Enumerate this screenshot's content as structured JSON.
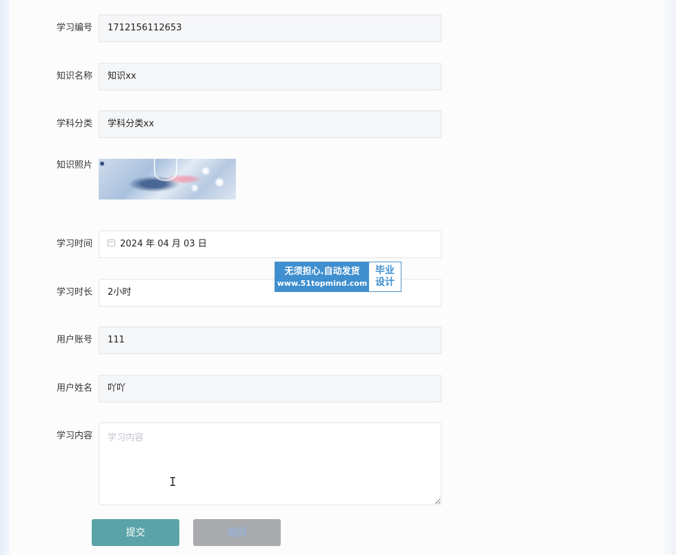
{
  "form": {
    "fields": [
      {
        "label": "学习编号",
        "value": "1712156112653"
      },
      {
        "label": "知识名称",
        "value": "知识xx"
      },
      {
        "label": "学科分类",
        "value": "学科分类xx"
      },
      {
        "label": "知识照片"
      },
      {
        "label": "学习时间",
        "value": "2024 年 04 月 03 日"
      },
      {
        "label": "学习时长",
        "value": "2小时"
      },
      {
        "label": "用户账号",
        "value": "111"
      },
      {
        "label": "用户姓名",
        "value": "吖吖"
      },
      {
        "label": "学习内容",
        "placeholder": "学习内容"
      }
    ],
    "buttons": {
      "submit": "提交",
      "back": "返回"
    }
  },
  "watermark": {
    "line1": "无须担心.自动发货",
    "line2": "www.51topmind.com",
    "right_top": "毕业",
    "right_bottom": "设计"
  },
  "colors": {
    "submit_bg": "#5aa3a8",
    "back_bg": "#a8aaad",
    "field_bg": "#f5f6f8",
    "watermark_blue": "#3f8fcf"
  },
  "icons": [
    "calendar-icon",
    "text-cursor-icon"
  ]
}
